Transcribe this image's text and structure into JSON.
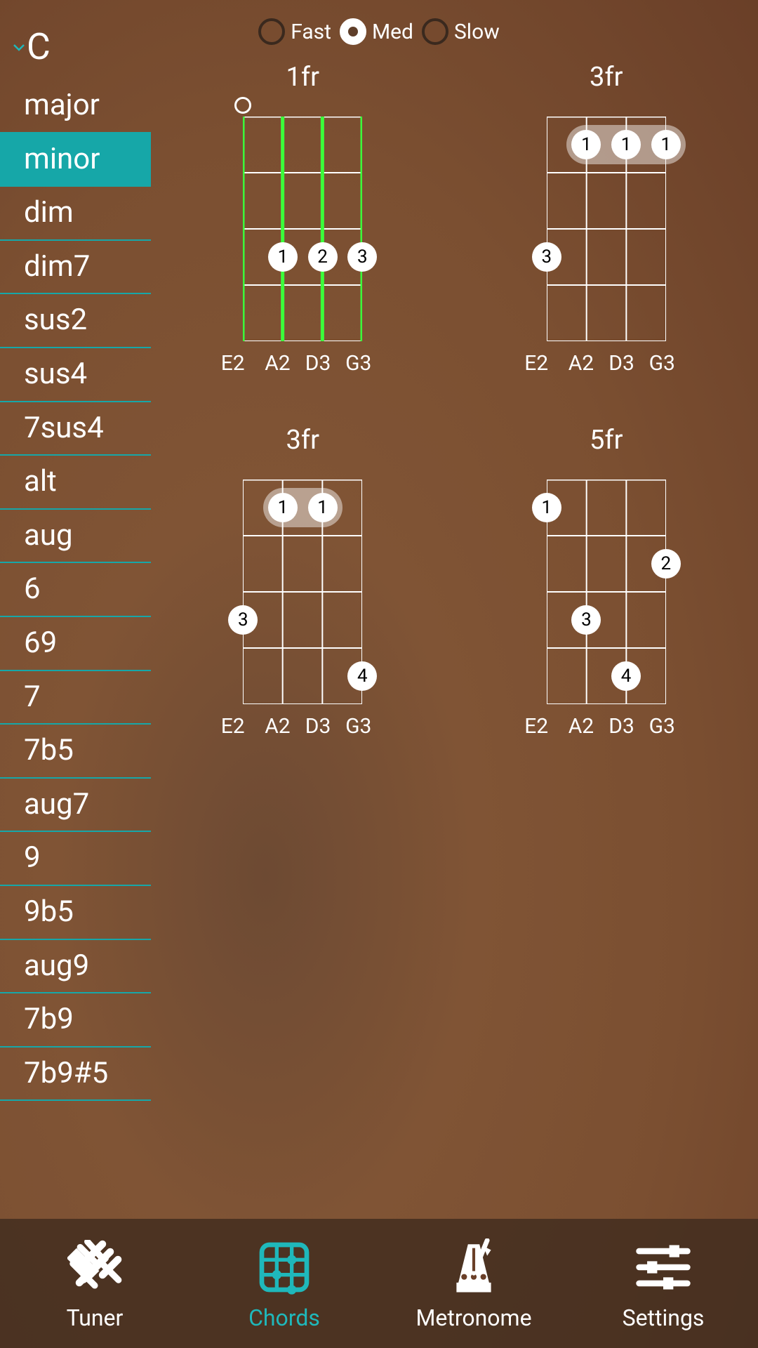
{
  "speed": {
    "fast": "Fast",
    "med": "Med",
    "slow": "Slow",
    "selected": "med"
  },
  "root": "C",
  "qualities": [
    "major",
    "minor",
    "dim",
    "dim7",
    "sus2",
    "sus4",
    "7sus4",
    "alt",
    "aug",
    "6",
    "69",
    "7",
    "7b5",
    "aug7",
    "9",
    "9b5",
    "aug9",
    "7b9",
    "7b9#5"
  ],
  "selected_quality_index": 1,
  "string_labels": [
    "E2",
    "A2",
    "D3",
    "G3"
  ],
  "diagrams": [
    {
      "fret_label": "1fr",
      "highlighted": true,
      "open": [
        {
          "string": 0
        }
      ],
      "barre": null,
      "fingers": [
        {
          "string": 1,
          "fret": 3,
          "num": "1"
        },
        {
          "string": 2,
          "fret": 3,
          "num": "2"
        },
        {
          "string": 3,
          "fret": 3,
          "num": "3"
        }
      ]
    },
    {
      "fret_label": "3fr",
      "highlighted": false,
      "open": [],
      "barre": {
        "from_string": 1,
        "to_string": 3,
        "fret": 1
      },
      "fingers": [
        {
          "string": 1,
          "fret": 1,
          "num": "1"
        },
        {
          "string": 2,
          "fret": 1,
          "num": "1"
        },
        {
          "string": 3,
          "fret": 1,
          "num": "1"
        },
        {
          "string": 0,
          "fret": 3,
          "num": "3"
        }
      ]
    },
    {
      "fret_label": "3fr",
      "highlighted": false,
      "open": [],
      "barre": {
        "from_string": 1,
        "to_string": 2,
        "fret": 1
      },
      "fingers": [
        {
          "string": 1,
          "fret": 1,
          "num": "1"
        },
        {
          "string": 2,
          "fret": 1,
          "num": "1"
        },
        {
          "string": 0,
          "fret": 3,
          "num": "3"
        },
        {
          "string": 3,
          "fret": 4,
          "num": "4"
        }
      ]
    },
    {
      "fret_label": "5fr",
      "highlighted": false,
      "open": [],
      "barre": null,
      "fingers": [
        {
          "string": 0,
          "fret": 1,
          "num": "1"
        },
        {
          "string": 3,
          "fret": 2,
          "num": "2"
        },
        {
          "string": 1,
          "fret": 3,
          "num": "3"
        },
        {
          "string": 2,
          "fret": 4,
          "num": "4"
        }
      ]
    }
  ],
  "nav": {
    "tuner": "Tuner",
    "chords": "Chords",
    "metronome": "Metronome",
    "settings": "Settings",
    "active": "chords"
  },
  "colors": {
    "accent": "#1fb8bb",
    "highlight_string": "#3bff3b"
  }
}
